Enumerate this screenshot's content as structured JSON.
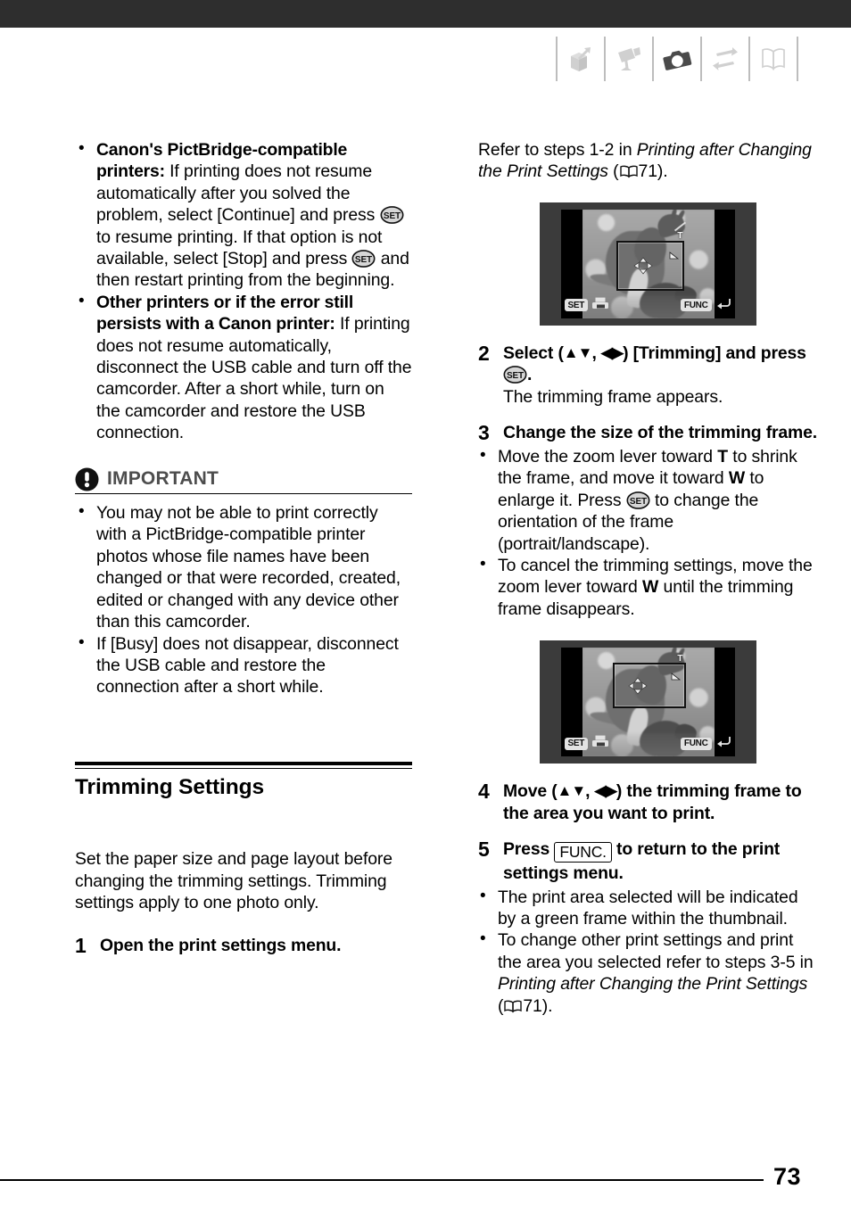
{
  "header": {
    "icons": [
      {
        "name": "box-open-arrow-icon",
        "label": "Introduction"
      },
      {
        "name": "camcorder-icon",
        "label": "Video"
      },
      {
        "name": "camera-icon",
        "label": "Photos"
      },
      {
        "name": "transfer-arrows-icon",
        "label": "External Connections"
      },
      {
        "name": "open-book-icon",
        "label": "Additional Information"
      }
    ],
    "active_index": 2
  },
  "left_column": {
    "printer_bullets": [
      {
        "lead": "Canon's PictBridge-compatible printers:",
        "text_1": " If printing does not resume automatically after you solved the problem, select [Continue] and press ",
        "icon_1": "SET",
        "text_2": " to resume printing. If that option is not available, select [Stop] and press ",
        "icon_2": "SET",
        "text_3": " and then restart printing from the beginning."
      },
      {
        "lead": "Other printers or if the error still persists with a Canon printer:",
        "text_1": " If printing does not resume automatically, disconnect the USB cable and turn off the camcorder. After a short while, turn on the camcorder and restore the USB connection."
      }
    ],
    "important": {
      "label": "IMPORTANT",
      "icon": "exclamation-circle-icon",
      "bullets": [
        "You may not be able to print correctly with a PictBridge-compatible printer photos whose file names have been changed or that were recorded, created, edited or changed with any device other than this camcorder.",
        "If [Busy] does not disappear, disconnect the USB cable and restore the connection after a short while."
      ]
    },
    "section": {
      "title": "Trimming Settings",
      "intro": "Set the paper size and page layout before changing the trimming settings. Trimming settings apply to one photo only.",
      "step_1": {
        "number": "1",
        "text": "Open the print settings menu."
      }
    }
  },
  "right_column": {
    "refer_text_1": "Refer to steps 1-2 in ",
    "refer_italic": "Printing after Changing the Print Settings",
    "refer_text_2": " (",
    "refer_page": "71",
    "refer_text_3": ").",
    "screen_1": {
      "set_badge": "SET",
      "set_icon": "print-icon",
      "func_badge": "FUNC",
      "func_icon": "return-arrow-icon",
      "zoom_mark": "T"
    },
    "step_2": {
      "number": "2",
      "text_1": "Select (",
      "arrows_1": "▲▼",
      "text_2": ", ",
      "arrows_2": "◀▶",
      "text_3": ") [Trimming] and press ",
      "icon": "SET",
      "text_4": ".",
      "note": "The trimming frame appears."
    },
    "step_3": {
      "number": "3",
      "text": "Change the size of the trimming frame.",
      "bullets": [
        {
          "text_1": "Move the zoom lever toward ",
          "bold_1": "T",
          "text_2": " to shrink the frame, and move it toward ",
          "bold_2": "W",
          "text_3": " to enlarge it. Press ",
          "icon": "SET",
          "text_4": " to change the orientation of the frame (portrait/landscape)."
        },
        {
          "text_1": "To cancel the trimming settings, move the zoom lever toward ",
          "bold_1": "W",
          "text_2": " until the trimming frame disappears."
        }
      ]
    },
    "screen_2": {
      "set_badge": "SET",
      "set_icon": "print-icon",
      "func_badge": "FUNC",
      "func_icon": "return-arrow-icon",
      "zoom_mark": "T"
    },
    "step_4": {
      "number": "4",
      "text_1": "Move (",
      "arrows_1": "▲▼",
      "text_2": ", ",
      "arrows_2": "◀▶",
      "text_3": ") the trimming frame to the area you want to print."
    },
    "step_5": {
      "number": "5",
      "text_1": "Press ",
      "button": "FUNC.",
      "text_2": " to return to the print settings menu.",
      "bullets": [
        {
          "text_1": "The print area selected will be indicated by a green frame within the thumbnail."
        },
        {
          "text_1": "To change other print settings and print the area you selected refer to steps 3-5 in ",
          "italic_1": "Printing after Changing the Print Settings",
          "text_2": " (",
          "page_ref": "71",
          "text_3": ")."
        }
      ]
    }
  },
  "footer": {
    "page_number": "73"
  },
  "colors": {
    "top_bar": "#2e2e2e",
    "icon_inactive": "#d0d0d0",
    "icon_active": "#4a4a4a",
    "important_label": "#4d4d4d",
    "text": "#000000"
  }
}
